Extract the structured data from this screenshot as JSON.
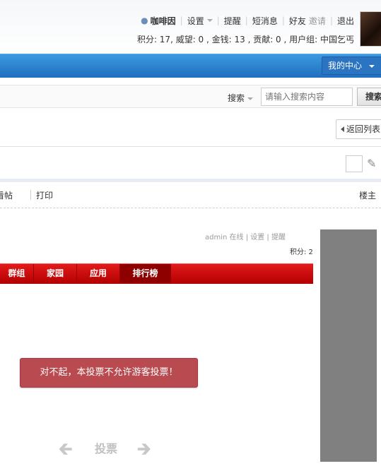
{
  "header": {
    "username": "咖啡因",
    "links": [
      "设置",
      "提醒",
      "短消息",
      "好友",
      "邀请",
      "退出"
    ],
    "credits": "积分: 17, 威望: 0 , 金钱: 13 , 贡献: 0 , 用户组: 中国乞丐"
  },
  "nav": {
    "my_center": "我的中心"
  },
  "search": {
    "label": "搜索",
    "placeholder": "请输入搜索内容",
    "button": "搜索"
  },
  "thread": {
    "back_label": "返回列表",
    "only_author": "看帖",
    "print": "打印",
    "floor": "楼主"
  },
  "embedded": {
    "user_line": "admin 在线 | 设置 | 提醒",
    "credits": "积分: 2",
    "nav_items": [
      "群组",
      "家园",
      "应用",
      "排行榜"
    ],
    "active_nav": "排行榜"
  },
  "alert": {
    "message": "对不起，本投票不允许游客投票！"
  },
  "vote": {
    "label": "投票",
    "prev_icon": "arrow-left-icon",
    "next_icon": "arrow-right-icon"
  },
  "colors": {
    "blue_nav": "#1f6fbf",
    "red_nav": "#cc0000",
    "alert": "#b94a4f",
    "side_gray": "#808080"
  }
}
